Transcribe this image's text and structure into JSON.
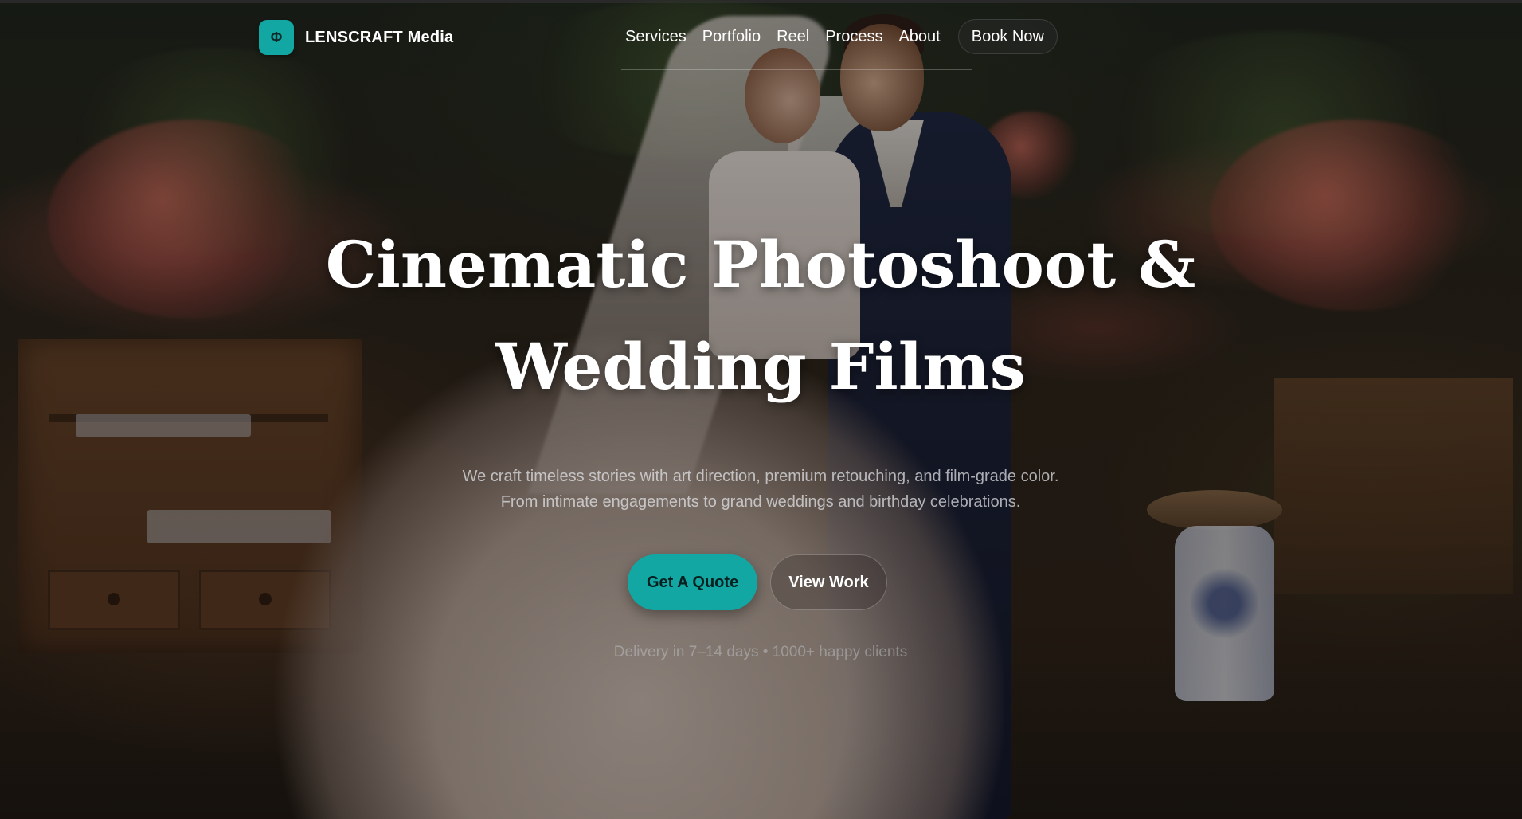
{
  "brand": {
    "mark_glyph": "Φ",
    "name": "LENSCRAFT Media",
    "accent_color": "#12a7a3"
  },
  "nav": {
    "links": [
      "Services",
      "Portfolio",
      "Reel",
      "Process",
      "About"
    ],
    "book_label": "Book Now"
  },
  "hero": {
    "title": "Cinematic Photoshoot & Wedding Films",
    "subtitle": "We craft timeless stories with art direction, premium retouching, and film-grade color. From intimate engagements to grand weddings and birthday celebrations.",
    "primary_cta": "Get A Quote",
    "secondary_cta": "View Work",
    "meta": "Delivery in 7–14 days • 1000+ happy clients"
  }
}
